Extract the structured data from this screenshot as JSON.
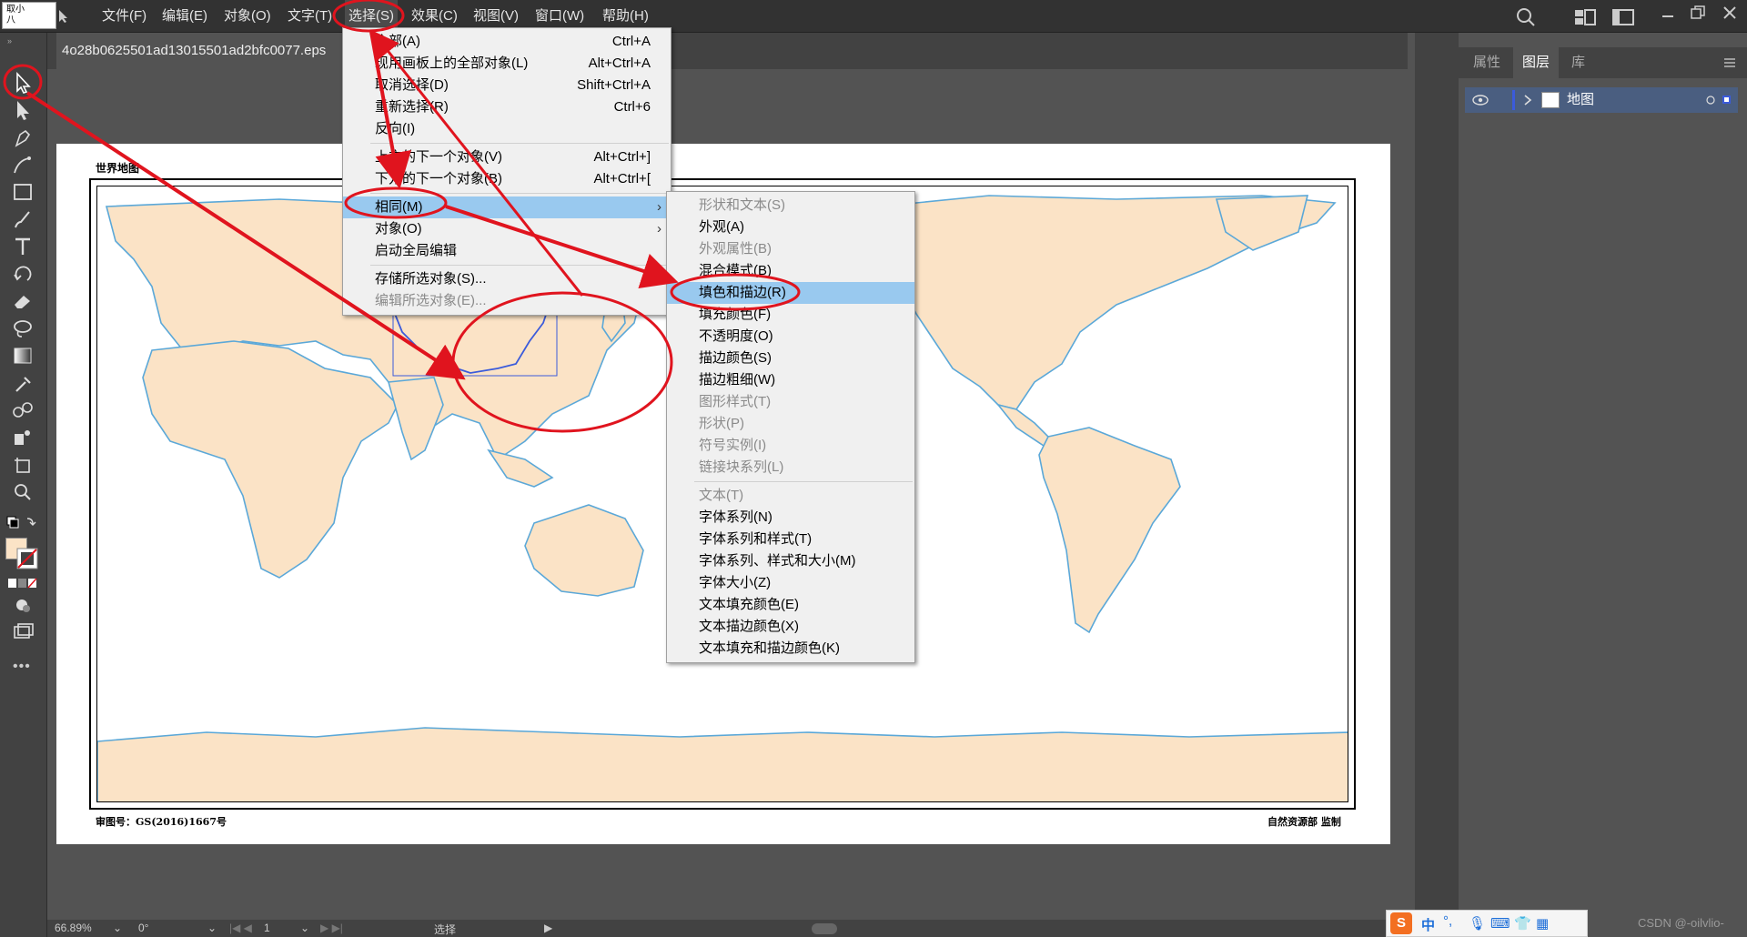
{
  "menubar": {
    "logo_line1": "取小",
    "logo_line2": "八",
    "items": [
      "文件(F)",
      "编辑(E)",
      "对象(O)",
      "文字(T)",
      "选择(S)",
      "效果(C)",
      "视图(V)",
      "窗口(W)",
      "帮助(H)"
    ]
  },
  "document": {
    "tab_title": "4o28b0625501ad13015501ad2bfc0077.eps"
  },
  "select_menu": {
    "items": [
      {
        "label": "全部(A)",
        "shortcut": "Ctrl+A"
      },
      {
        "label": "现用画板上的全部对象(L)",
        "shortcut": "Alt+Ctrl+A"
      },
      {
        "label": "取消选择(D)",
        "shortcut": "Shift+Ctrl+A"
      },
      {
        "label": "重新选择(R)",
        "shortcut": "Ctrl+6"
      },
      {
        "label": "反向(I)",
        "shortcut": ""
      },
      {
        "label": "上方的下一个对象(V)",
        "shortcut": "Alt+Ctrl+]"
      },
      {
        "label": "下方的下一个对象(B)",
        "shortcut": "Alt+Ctrl+["
      },
      {
        "label": "相同(M)",
        "shortcut": ""
      },
      {
        "label": "对象(O)",
        "shortcut": ""
      },
      {
        "label": "启动全局编辑",
        "shortcut": ""
      },
      {
        "label": "存储所选对象(S)...",
        "shortcut": ""
      },
      {
        "label": "编辑所选对象(E)...",
        "shortcut": ""
      }
    ]
  },
  "same_submenu": {
    "items": [
      "形状和文本(S)",
      "外观(A)",
      "外观属性(B)",
      "混合模式(B)",
      "填色和描边(R)",
      "填充颜色(F)",
      "不透明度(O)",
      "描边颜色(S)",
      "描边粗细(W)",
      "图形样式(T)",
      "形状(P)",
      "符号实例(I)",
      "链接块系列(L)",
      "文本(T)",
      "字体系列(N)",
      "字体系列和样式(T)",
      "字体系列、样式和大小(M)",
      "字体大小(Z)",
      "文本填充颜色(E)",
      "文本描边颜色(X)",
      "文本填充和描边颜色(K)"
    ]
  },
  "map": {
    "title": "世界地图",
    "review_number": "审图号：GS(2016)1667号",
    "credit": "自然资源部 监制"
  },
  "right_panel": {
    "tabs": [
      "属性",
      "图层",
      "库"
    ],
    "layer_name": "地图"
  },
  "status": {
    "zoom": "66.89%",
    "rotation": "0°",
    "artboard": "1",
    "tool": "选择"
  },
  "ime": {
    "label": "中"
  },
  "watermark": "CSDN @-oilvlio-",
  "colors": {
    "land": "#fbe3c6",
    "coast": "#5ba8d8",
    "annotation": "#e0141e",
    "menu_highlight": "#99c9ef"
  }
}
